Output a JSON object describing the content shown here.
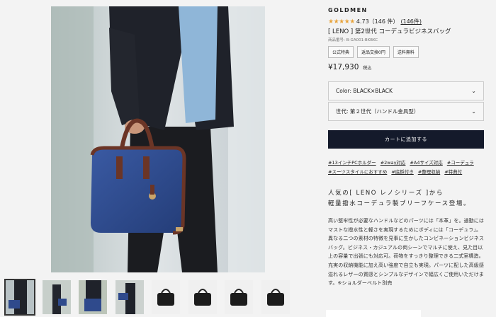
{
  "product": {
    "brand": "GOLDMEN",
    "stars": "★★★★★",
    "rating": "4.73（146 件）",
    "review_link": "(146件)",
    "title": "[ LENO ] 第2世代 コーデュラビジネスバッグ",
    "code": "商品番号: B-GA001-BKBKC",
    "badges": [
      "公式特典",
      "返品交換0円",
      "送料無料"
    ],
    "price": "¥17,930",
    "tax_label": "税込"
  },
  "options": {
    "color": "Color: BLACK×BLACK",
    "generation": "世代: 第２世代（ハンドル金具型）"
  },
  "cart_button": "カートに追加する",
  "tags": [
    "#13インチPCホルダー",
    "#2way対応",
    "#A4サイズ対応",
    "#コーデュラ",
    "#スーツスタイルにおすすめ",
    "#底鋲付き",
    "#整理収納",
    "#特典付"
  ],
  "lead": {
    "line1": "人気の[ LENO レノシリーズ ]から",
    "line2": "軽量撥水コーデュラ製ブリーフケース登場。"
  },
  "description": "高い堅牢性が必要なハンドルなどのパーツには「本革」を。通勤にはマストな撥水性と軽さを実現するためにボディには「コーデュラ」。異なる二つの素材の特徴を見事に生かしたコンビネーションビジネスバッグ。ビジネス・カジュアルの両シーンでマルチに使え、見た目以上の容量で出張にも対応可。荷物をすっきり整理できる二式室構造。充実の収納機能に加え高い強度で自立も実現。パーツに配した高級感溢れるレザーの質感とシンプルなデザインで幅広くご使用いただけます。※ショルダーベルト別売",
  "thumbnails": [
    "model-with-bag-thumbnail",
    "model-walking-thumbnail",
    "bag-closeup-thumbnail",
    "model-shoulder-thumbnail",
    "black-bag-front-thumbnail",
    "black-bag-side-thumbnail",
    "black-bag-angle-thumbnail",
    "black-bag-back-thumbnail"
  ],
  "colors": {
    "cart_button_bg": "#141a2b",
    "star": "#e8a33a",
    "bag_navy": "#2f4a8c",
    "leather_brown": "#6b3526"
  }
}
